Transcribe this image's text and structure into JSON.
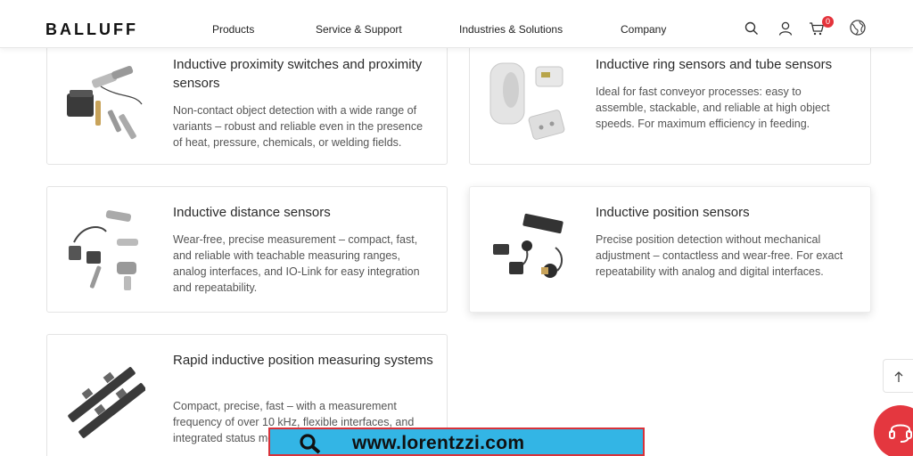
{
  "header": {
    "logo": "BALLUFF",
    "nav": [
      "Products",
      "Service & Support",
      "Industries & Solutions",
      "Company"
    ],
    "icons": [
      "search-icon",
      "user-icon",
      "cart-icon",
      "language-icon"
    ],
    "cart_count": "0"
  },
  "cards": [
    {
      "title": "Inductive proximity switches and proximity sensors",
      "description": "Non-contact object detection with a wide range of variants – robust and reliable even in the presence of heat, pressure, chemicals, or welding fields."
    },
    {
      "title": "Inductive ring sensors and tube sensors",
      "description": "Ideal for fast conveyor processes: easy to assemble, stackable, and reliable at high object speeds. For maximum efficiency in feeding."
    },
    {
      "title": "Inductive distance sensors",
      "description": "Wear-free, precise measurement – compact, fast, and reliable with teachable measuring ranges, analog interfaces, and IO-Link for easy integration and repeatability."
    },
    {
      "title": "Inductive position sensors",
      "description": "Precise position detection without mechanical adjustment – contactless and wear-free. For exact repeatability with analog and digital interfaces."
    },
    {
      "title": "Rapid inductive position measuring systems",
      "description": "Compact, precise, fast – with a measurement frequency of over 10 kHz, flexible interfaces, and integrated status monitoring."
    }
  ],
  "watermark": "www.lorentzzi.com",
  "colors": {
    "accent_red": "#e4373f",
    "watermark_blue": "#33b5e5",
    "text_dark": "#2a2a2a"
  }
}
